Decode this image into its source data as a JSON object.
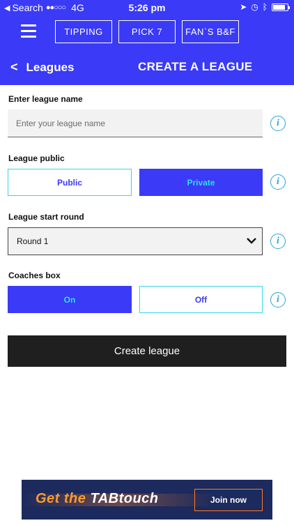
{
  "status_bar": {
    "back_app": "Search",
    "signal": "●●○○○",
    "network": "4G",
    "time": "5:26 pm"
  },
  "nav": {
    "tipping": "TIPPING",
    "pick7": "PICK 7",
    "fans": "FAN`S B&F"
  },
  "header": {
    "back_label": "Leagues",
    "title": "CREATE A LEAGUE"
  },
  "form": {
    "league_name": {
      "label": "Enter league name",
      "placeholder": "Enter your league name",
      "value": ""
    },
    "league_public": {
      "label": "League public",
      "option_public": "Public",
      "option_private": "Private",
      "selected": "Private"
    },
    "start_round": {
      "label": "League start round",
      "value": "Round 1"
    },
    "coaches_box": {
      "label": "Coaches box",
      "option_on": "On",
      "option_off": "Off",
      "selected": "On"
    },
    "info_glyph": "i",
    "submit_label": "Create league"
  },
  "ad": {
    "text_get": "Get the",
    "text_brand": "TABtouch",
    "join_label": "Join now"
  },
  "colors": {
    "primary": "#3a3af7",
    "accent_cyan": "#34d7e6",
    "info_blue": "#2aa4d8",
    "button_dark": "#1f1f1f"
  }
}
